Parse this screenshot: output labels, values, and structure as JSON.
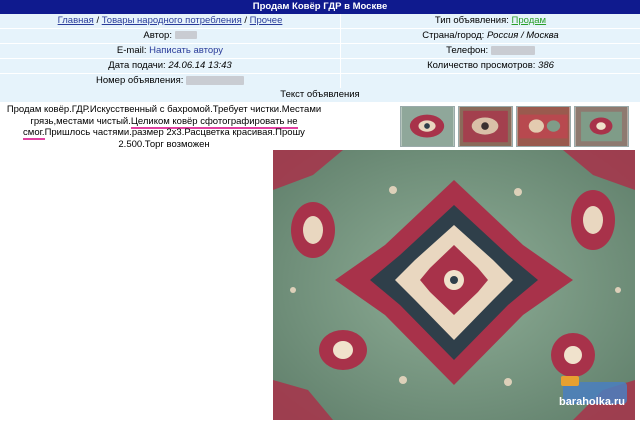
{
  "title": "Продам Ковёр ГДР в Москве",
  "breadcrumb": {
    "home": "Главная",
    "sep1": "/",
    "category": "Товары народного потребления",
    "sep2": "/",
    "sub": "Прочее"
  },
  "fields": {
    "ad_type_label": "Тип объявления:",
    "ad_type_value": "Продам",
    "author_label": "Автор:",
    "location_label": "Страна/город:",
    "location_value": "Россия / Москва",
    "email_label": "E-mail:",
    "email_link": "Написать автору",
    "phone_label": "Телефон:",
    "date_label": "Дата подачи:",
    "date_value": "24.06.14 13:43",
    "views_label": "Количество просмотров:",
    "views_value": "386",
    "ad_number_label": "Номер объявления:"
  },
  "section_title": "Текст объявления",
  "description": {
    "part1": "Продам ковёр.ГДР.Искусственный с бахромой.Требует чистки.Местами грязь,местами чистый.",
    "highlight": "Целиком ковёр сфотографировать не смог.",
    "part2": "Пришлось частями.размер 2х3.Расцветка красивая.Прошу 2.500.Торг возможен"
  },
  "watermark": "baraholka.ru",
  "colors": {
    "header_bg": "#0f1a8e",
    "row_bg": "#e6f3fb",
    "link": "#2a3c9a",
    "ad_type": "#2aa02a",
    "highlight_underline": "#e040a0",
    "carpet_green": "#7f9c88",
    "carpet_red": "#a8324a"
  }
}
